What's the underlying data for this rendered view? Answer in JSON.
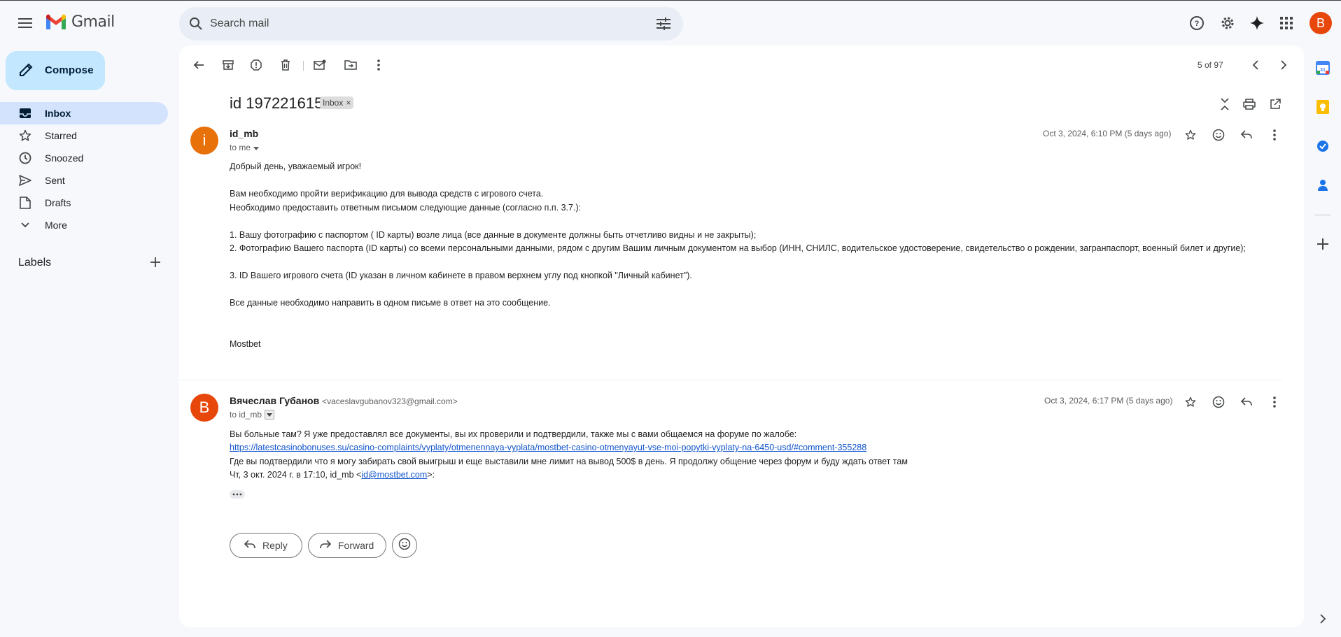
{
  "app": {
    "name": "Gmail"
  },
  "search": {
    "placeholder": "Search mail"
  },
  "account": {
    "avatar_letter": "B",
    "avatar_color": "#e8470b"
  },
  "sidebar": {
    "compose_label": "Compose",
    "items": [
      {
        "label": "Inbox",
        "icon": "inbox-icon",
        "active": true
      },
      {
        "label": "Starred",
        "icon": "star-icon"
      },
      {
        "label": "Snoozed",
        "icon": "clock-icon"
      },
      {
        "label": "Sent",
        "icon": "send-icon"
      },
      {
        "label": "Drafts",
        "icon": "draft-icon"
      },
      {
        "label": "More",
        "icon": "chevron-down-icon"
      }
    ],
    "labels_header": "Labels"
  },
  "toolbar": {
    "pager": "5 of 97"
  },
  "thread": {
    "subject": "id 197221615",
    "label_chip": "Inbox",
    "messages": [
      {
        "avatar_letter": "i",
        "avatar_color": "#e8710a",
        "sender": "id_mb",
        "to": "to me",
        "date": "Oct 3, 2024, 6:10 PM (5 days ago)",
        "lines": [
          "Добрый день, уважаемый игрок!",
          "Вам необходимо пройти верификацию для вывода средств с игрового счета.",
          "Необходимо предоставить ответным письмом следующие данные (согласно п.п. 3.7.):",
          "1. Вашу фотографию с паспортом ( ID карты) возле лица (все данные в документе должны быть отчетливо видны и не закрыты);",
          "2. Фотографию Вашего паспорта (ID карты) со всеми персональными данными, рядом с другим Вашим личным документом на выбор (ИНН, СНИЛС, водительское удостоверение, свидетельство о рождении, загранпаспорт, военный билет и другие);",
          "3. ID Вашего игрового счета (ID указан в личном кабинете в правом верхнем углу под кнопкой \"Личный кабинет\").",
          "Все данные необходимо направить в одном письме в ответ на это сообщение.",
          "Mostbet"
        ]
      },
      {
        "avatar_letter": "В",
        "avatar_color": "#e8470b",
        "sender": "Вячеслав Губанов",
        "sender_email": "<vaceslavgubanov323@gmail.com>",
        "to": "to id_mb",
        "date": "Oct 3, 2024, 6:17 PM (5 days ago)",
        "line1": "Вы больные там? Я уже предоставлял все документы, вы их проверили и подтвердили, также мы с вами общаемся на форуме по жалобе:",
        "link": "https://latestcasinobonuses.su/casino-complaints/vyplaty/otmenennaya-vyplata/mostbet-casino-otmenyayut-vse-moi-popytki-vyplaty-na-6450-usd/#comment-355288",
        "line2": "Где вы подтвердили что я могу забирать свой выигрыш и еще выставили мне лимит на вывод 500$ в день. Я продолжу общение через форум и буду ждать ответ там",
        "quote_prefix": "Чт, 3 окт. 2024 г. в 17:10, id_mb <",
        "quote_email": "id@mostbet.com",
        "quote_suffix": ">:"
      }
    ]
  },
  "actions": {
    "reply": "Reply",
    "forward": "Forward"
  }
}
